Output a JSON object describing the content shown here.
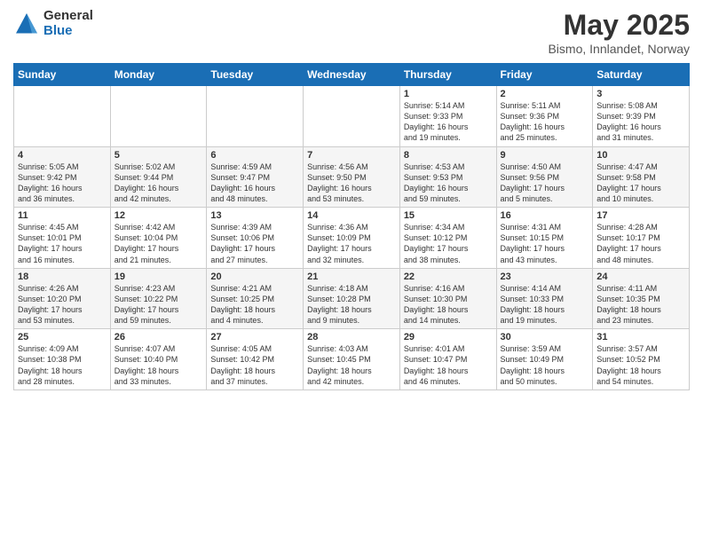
{
  "header": {
    "logo_general": "General",
    "logo_blue": "Blue",
    "month": "May 2025",
    "location": "Bismo, Innlandet, Norway"
  },
  "weekdays": [
    "Sunday",
    "Monday",
    "Tuesday",
    "Wednesday",
    "Thursday",
    "Friday",
    "Saturday"
  ],
  "weeks": [
    [
      {
        "day": "",
        "info": ""
      },
      {
        "day": "",
        "info": ""
      },
      {
        "day": "",
        "info": ""
      },
      {
        "day": "",
        "info": ""
      },
      {
        "day": "1",
        "info": "Sunrise: 5:14 AM\nSunset: 9:33 PM\nDaylight: 16 hours\nand 19 minutes."
      },
      {
        "day": "2",
        "info": "Sunrise: 5:11 AM\nSunset: 9:36 PM\nDaylight: 16 hours\nand 25 minutes."
      },
      {
        "day": "3",
        "info": "Sunrise: 5:08 AM\nSunset: 9:39 PM\nDaylight: 16 hours\nand 31 minutes."
      }
    ],
    [
      {
        "day": "4",
        "info": "Sunrise: 5:05 AM\nSunset: 9:42 PM\nDaylight: 16 hours\nand 36 minutes."
      },
      {
        "day": "5",
        "info": "Sunrise: 5:02 AM\nSunset: 9:44 PM\nDaylight: 16 hours\nand 42 minutes."
      },
      {
        "day": "6",
        "info": "Sunrise: 4:59 AM\nSunset: 9:47 PM\nDaylight: 16 hours\nand 48 minutes."
      },
      {
        "day": "7",
        "info": "Sunrise: 4:56 AM\nSunset: 9:50 PM\nDaylight: 16 hours\nand 53 minutes."
      },
      {
        "day": "8",
        "info": "Sunrise: 4:53 AM\nSunset: 9:53 PM\nDaylight: 16 hours\nand 59 minutes."
      },
      {
        "day": "9",
        "info": "Sunrise: 4:50 AM\nSunset: 9:56 PM\nDaylight: 17 hours\nand 5 minutes."
      },
      {
        "day": "10",
        "info": "Sunrise: 4:47 AM\nSunset: 9:58 PM\nDaylight: 17 hours\nand 10 minutes."
      }
    ],
    [
      {
        "day": "11",
        "info": "Sunrise: 4:45 AM\nSunset: 10:01 PM\nDaylight: 17 hours\nand 16 minutes."
      },
      {
        "day": "12",
        "info": "Sunrise: 4:42 AM\nSunset: 10:04 PM\nDaylight: 17 hours\nand 21 minutes."
      },
      {
        "day": "13",
        "info": "Sunrise: 4:39 AM\nSunset: 10:06 PM\nDaylight: 17 hours\nand 27 minutes."
      },
      {
        "day": "14",
        "info": "Sunrise: 4:36 AM\nSunset: 10:09 PM\nDaylight: 17 hours\nand 32 minutes."
      },
      {
        "day": "15",
        "info": "Sunrise: 4:34 AM\nSunset: 10:12 PM\nDaylight: 17 hours\nand 38 minutes."
      },
      {
        "day": "16",
        "info": "Sunrise: 4:31 AM\nSunset: 10:15 PM\nDaylight: 17 hours\nand 43 minutes."
      },
      {
        "day": "17",
        "info": "Sunrise: 4:28 AM\nSunset: 10:17 PM\nDaylight: 17 hours\nand 48 minutes."
      }
    ],
    [
      {
        "day": "18",
        "info": "Sunrise: 4:26 AM\nSunset: 10:20 PM\nDaylight: 17 hours\nand 53 minutes."
      },
      {
        "day": "19",
        "info": "Sunrise: 4:23 AM\nSunset: 10:22 PM\nDaylight: 17 hours\nand 59 minutes."
      },
      {
        "day": "20",
        "info": "Sunrise: 4:21 AM\nSunset: 10:25 PM\nDaylight: 18 hours\nand 4 minutes."
      },
      {
        "day": "21",
        "info": "Sunrise: 4:18 AM\nSunset: 10:28 PM\nDaylight: 18 hours\nand 9 minutes."
      },
      {
        "day": "22",
        "info": "Sunrise: 4:16 AM\nSunset: 10:30 PM\nDaylight: 18 hours\nand 14 minutes."
      },
      {
        "day": "23",
        "info": "Sunrise: 4:14 AM\nSunset: 10:33 PM\nDaylight: 18 hours\nand 19 minutes."
      },
      {
        "day": "24",
        "info": "Sunrise: 4:11 AM\nSunset: 10:35 PM\nDaylight: 18 hours\nand 23 minutes."
      }
    ],
    [
      {
        "day": "25",
        "info": "Sunrise: 4:09 AM\nSunset: 10:38 PM\nDaylight: 18 hours\nand 28 minutes."
      },
      {
        "day": "26",
        "info": "Sunrise: 4:07 AM\nSunset: 10:40 PM\nDaylight: 18 hours\nand 33 minutes."
      },
      {
        "day": "27",
        "info": "Sunrise: 4:05 AM\nSunset: 10:42 PM\nDaylight: 18 hours\nand 37 minutes."
      },
      {
        "day": "28",
        "info": "Sunrise: 4:03 AM\nSunset: 10:45 PM\nDaylight: 18 hours\nand 42 minutes."
      },
      {
        "day": "29",
        "info": "Sunrise: 4:01 AM\nSunset: 10:47 PM\nDaylight: 18 hours\nand 46 minutes."
      },
      {
        "day": "30",
        "info": "Sunrise: 3:59 AM\nSunset: 10:49 PM\nDaylight: 18 hours\nand 50 minutes."
      },
      {
        "day": "31",
        "info": "Sunrise: 3:57 AM\nSunset: 10:52 PM\nDaylight: 18 hours\nand 54 minutes."
      }
    ]
  ]
}
